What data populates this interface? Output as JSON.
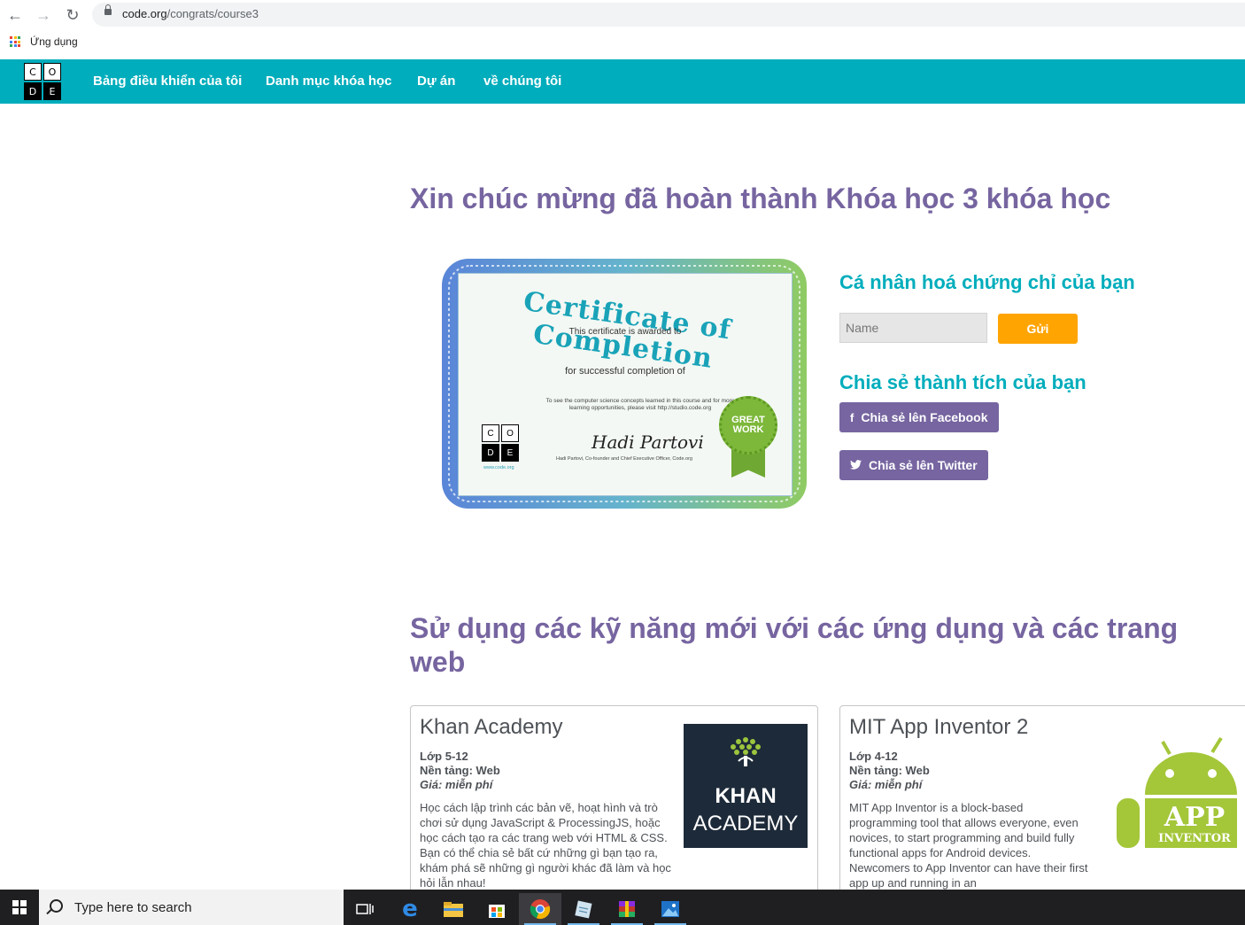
{
  "browser": {
    "url_host": "code.org",
    "url_path": "/congrats/course3",
    "bookmark_apps_label": "Ứng dụng"
  },
  "site": {
    "logo_letters": [
      "C",
      "O",
      "D",
      "E"
    ],
    "nav": [
      "Bảng điều khiển của tôi",
      "Danh mục khóa học",
      "Dự án",
      "về chúng tôi"
    ],
    "brand_color": "#00adbc",
    "accent_purple": "#7665a0",
    "accent_orange": "#ffa400"
  },
  "main": {
    "title": "Xin chúc mừng đã hoàn thành Khóa học 3 khóa học",
    "apps_title": "Sử dụng các kỹ năng mới với các ứng dụng và các trang web"
  },
  "certificate": {
    "title": "Certificate of Completion",
    "awarded_line": "This certificate is awarded to",
    "completion_line": "for successful completion of",
    "info_text": "To see the computer science concepts learned in this course and for more learning opportunities, please visit http://studio.code.org",
    "logo_letters": [
      "C",
      "O",
      "D",
      "E"
    ],
    "site": "www.code.org",
    "signature": "Hadi Partovi",
    "signer": "Hadi Partovi, Co-founder and Chief Executive Officer, Code.org",
    "seal_text": "GREAT WORK"
  },
  "personalize": {
    "title": "Cá nhân hoá chứng chỉ của bạn",
    "name_placeholder": "Name",
    "submit_label": "Gửi"
  },
  "share": {
    "title": "Chia sẻ thành tích của bạn",
    "facebook_label": "Chia sẻ lên Facebook",
    "twitter_label": "Chia sẻ lên Twitter"
  },
  "cards": [
    {
      "title": "Khan Academy",
      "grade": "Lớp 5-12",
      "platform": "Nền tảng: Web",
      "price": "Giá: miễn phí",
      "description": "Học cách lập trình các bản vẽ, hoạt hình và trò chơi sử dụng JavaScript & ProcessingJS, hoặc học cách tạo ra các trang web với HTML & CSS. Bạn có thể chia sẻ bất cứ những gì bạn tạo ra, khám phá sẽ những gì người khác đã làm và học hỏi lẫn nhau!",
      "logo_line1": "KHAN",
      "logo_line2": "ACADEMY"
    },
    {
      "title": "MIT App Inventor 2",
      "grade": "Lớp 4-12",
      "platform": "Nền tảng: Web",
      "price": "Giá: miễn phí",
      "description": "MIT App Inventor is a block-based programming tool that allows everyone, even novices, to start programming and build fully functional apps for Android devices. Newcomers to App Inventor can have their first app up and running in an",
      "logo_line1": "APP",
      "logo_line2": "INVENTOR"
    }
  ],
  "taskbar": {
    "search_placeholder": "Type here to search"
  }
}
